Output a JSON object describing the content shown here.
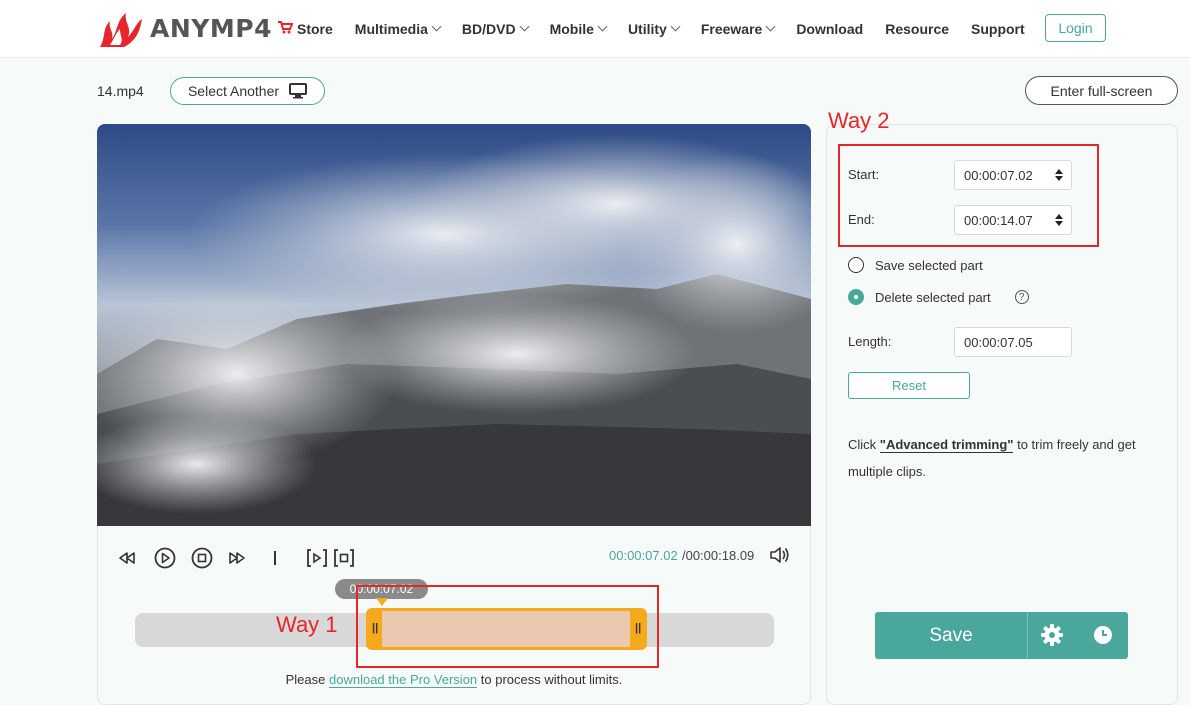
{
  "nav": {
    "logo_text": "ANYMP4",
    "items": [
      {
        "label": "Store",
        "icon": "cart-icon",
        "dropdown": false
      },
      {
        "label": "Multimedia",
        "dropdown": true
      },
      {
        "label": "BD/DVD",
        "dropdown": true
      },
      {
        "label": "Mobile",
        "dropdown": true
      },
      {
        "label": "Utility",
        "dropdown": true
      },
      {
        "label": "Freeware",
        "dropdown": true
      },
      {
        "label": "Download",
        "dropdown": false
      },
      {
        "label": "Resource",
        "dropdown": false
      },
      {
        "label": "Support",
        "dropdown": false
      }
    ],
    "login_label": "Login"
  },
  "file": {
    "name": "14.mp4",
    "select_another_label": "Select Another",
    "fullscreen_label": "Enter full-screen"
  },
  "player": {
    "current_time": "00:00:07.02",
    "total_time": "/00:00:18.09",
    "tooltip_time": "00:00:07.02"
  },
  "timeline": {
    "selection_start_fraction": 0.388,
    "selection_end_fraction": 0.78
  },
  "annotations": {
    "way1": "Way 1",
    "way2": "Way 2"
  },
  "trim": {
    "start_label": "Start:",
    "start_value": "00:00:07.02",
    "end_label": "End:",
    "end_value": "00:00:14.07",
    "save_part_label": "Save selected part",
    "delete_part_label": "Delete selected part",
    "help_glyph": "?",
    "length_label": "Length:",
    "length_value": "00:00:07.05",
    "reset_label": "Reset",
    "advanced_prefix": "Click ",
    "advanced_link": "\"Advanced trimming\"",
    "advanced_suffix": " to trim freely and get multiple clips."
  },
  "footer": {
    "pro_prefix": "Please ",
    "pro_link": "download the Pro Version",
    "pro_suffix": " to process without limits."
  },
  "actions": {
    "save_label": "Save"
  },
  "colors": {
    "accent": "#4aa79c",
    "annotation_red": "#e5262c",
    "selection_orange": "#f6a91c"
  }
}
